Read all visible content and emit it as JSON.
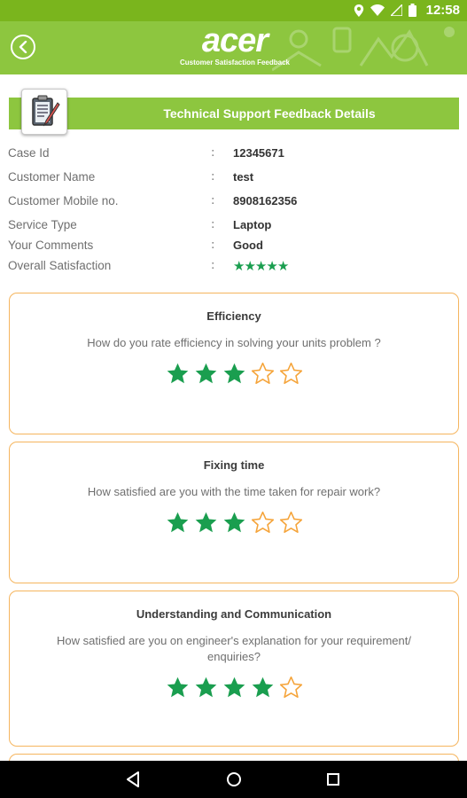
{
  "status_bar": {
    "time": "12:58"
  },
  "header": {
    "logo_text": "acer",
    "subtitle": "Customer Satisfaction Feedback"
  },
  "section": {
    "title": "Technical Support Feedback Details"
  },
  "details": [
    {
      "label": "Case Id",
      "value": "12345671"
    },
    {
      "label": "Customer Name",
      "value": "test"
    },
    {
      "label": "Customer Mobile no.",
      "value": "8908162356"
    },
    {
      "label": "Service Type",
      "value": "Laptop"
    },
    {
      "label": "Your Comments",
      "value": "Good"
    },
    {
      "label": "Overall Satisfaction",
      "rating": 5
    }
  ],
  "separator": ":",
  "cards": [
    {
      "title": "Efficiency",
      "question": "How do you rate efficiency in solving your units problem ?",
      "rating": 3,
      "max": 5
    },
    {
      "title": "Fixing time",
      "question": "How satisfied are you with the time taken for repair work?",
      "rating": 3,
      "max": 5
    },
    {
      "title": "Understanding and Communication",
      "question": "How satisfied are you on engineer's explanation for your requirement/ enquiries?",
      "rating": 4,
      "max": 5
    }
  ],
  "colors": {
    "brand_green": "#8dc63f",
    "star_filled": "#1a9e4f",
    "star_empty": "#f5a43a",
    "card_border": "#f5b55e"
  }
}
